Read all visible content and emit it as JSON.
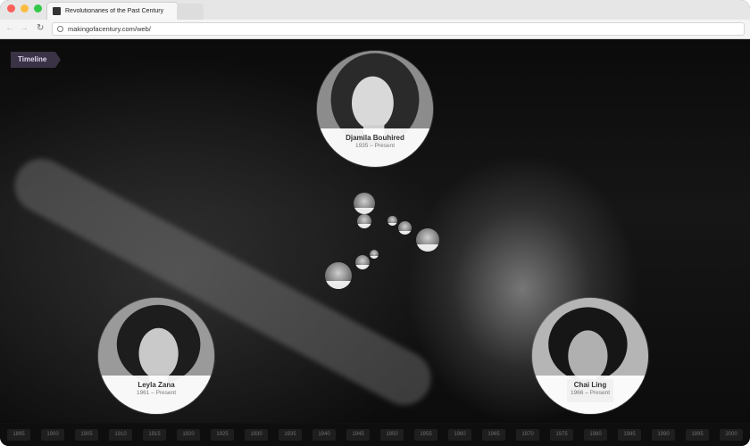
{
  "browser": {
    "tab_title": "Revolutionaries of the Past Century",
    "url": "makingofacentury.com/web/"
  },
  "timeline_label": "Timeline",
  "featured": [
    {
      "name": "Djamila Bouhired",
      "years": "1935 – Present"
    },
    {
      "name": "Leyla Zana",
      "years": "1961 – Present"
    },
    {
      "name": "Chai Ling",
      "years": "1966 – Present"
    }
  ],
  "year_scale": [
    "1895",
    "1900",
    "1905",
    "1910",
    "1915",
    "1920",
    "1925",
    "1930",
    "1935",
    "1940",
    "1945",
    "1950",
    "1955",
    "1960",
    "1965",
    "1970",
    "1975",
    "1980",
    "1985",
    "1990",
    "1995",
    "2000"
  ]
}
